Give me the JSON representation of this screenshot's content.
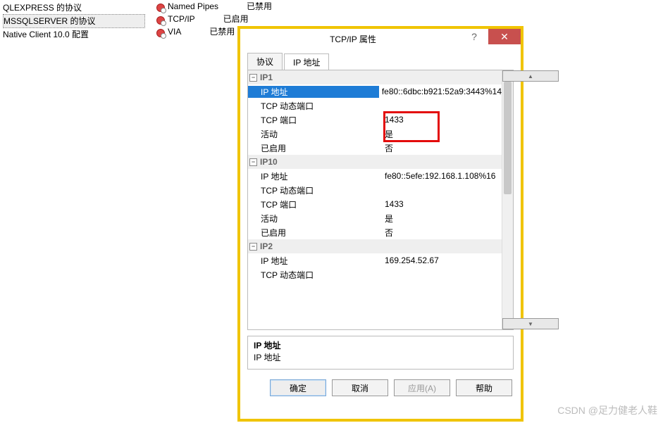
{
  "tree": {
    "items": [
      {
        "label": "QLEXPRESS 的协议",
        "selected": false
      },
      {
        "label": "MSSQLSERVER 的协议",
        "selected": true
      },
      {
        "label": "Native Client 10.0 配置",
        "selected": false
      }
    ]
  },
  "protocol_list": [
    {
      "name": "Named Pipes",
      "state": "已禁用"
    },
    {
      "name": "TCP/IP",
      "state": "已启用"
    },
    {
      "name": "VIA",
      "state": "已禁用"
    }
  ],
  "dialog": {
    "title": "TCP/IP 属性",
    "help_icon": "?",
    "close_icon": "✕",
    "tabs": [
      {
        "label": "协议",
        "active": false
      },
      {
        "label": "IP 地址",
        "active": true
      }
    ],
    "groups": [
      {
        "name": "IP1",
        "rows": [
          {
            "label": "IP 地址",
            "value": "fe80::6dbc:b921:52a9:3443%14",
            "selected": true
          },
          {
            "label": "TCP 动态端口",
            "value": ""
          },
          {
            "label": "TCP 端口",
            "value": "1433"
          },
          {
            "label": "活动",
            "value": "是"
          },
          {
            "label": "已启用",
            "value": "否"
          }
        ]
      },
      {
        "name": "IP10",
        "rows": [
          {
            "label": "IP 地址",
            "value": "fe80::5efe:192.168.1.108%16"
          },
          {
            "label": "TCP 动态端口",
            "value": ""
          },
          {
            "label": "TCP 端口",
            "value": "1433"
          },
          {
            "label": "活动",
            "value": "是"
          },
          {
            "label": "已启用",
            "value": "否"
          }
        ]
      },
      {
        "name": "IP2",
        "rows": [
          {
            "label": "IP 地址",
            "value": "169.254.52.67"
          },
          {
            "label": "TCP 动态端口",
            "value": ""
          }
        ]
      }
    ],
    "description": {
      "title": "IP 地址",
      "text": "IP 地址"
    },
    "buttons": {
      "ok": "确定",
      "cancel": "取消",
      "apply": "应用(A)",
      "help": "帮助"
    }
  },
  "watermark": "CSDN @足力健老人鞋",
  "scroll": {
    "up": "▲",
    "down": "▼"
  },
  "toggle_glyph": "−"
}
